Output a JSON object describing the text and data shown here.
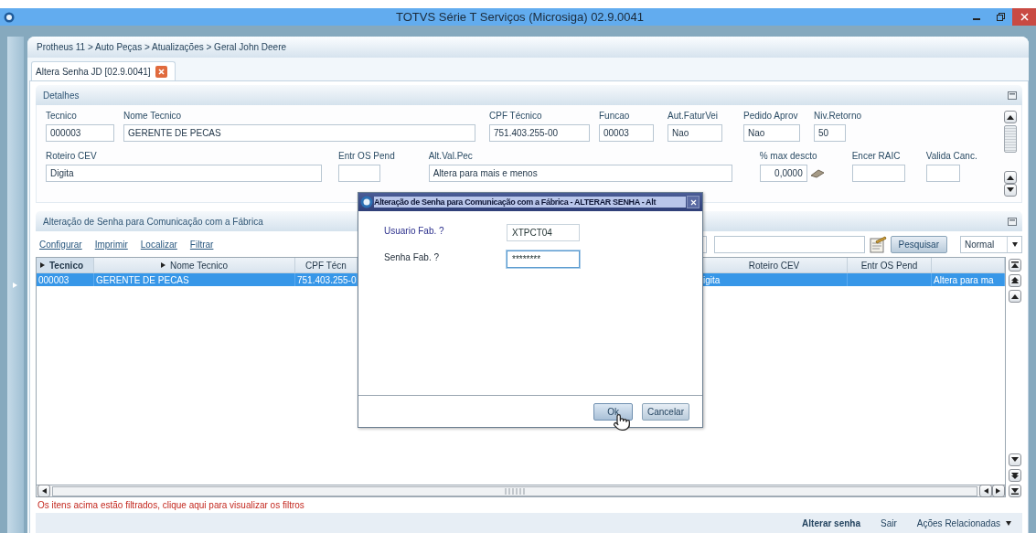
{
  "window": {
    "title": "TOTVS Série T Serviços (Microsiga) 02.9.0041"
  },
  "breadcrumb": "Protheus 11 > Auto Peças > Atualizações > Geral John Deere",
  "tabs": [
    {
      "label": "Altera Senha JD [02.9.0041]",
      "selected": true
    }
  ],
  "details": {
    "title": "Detalhes",
    "fields": [
      {
        "label": "Tecnico",
        "value": "000003"
      },
      {
        "label": "Nome Tecnico",
        "value": "GERENTE DE PECAS"
      },
      {
        "label": "CPF Técnico",
        "value": "751.403.255-00"
      },
      {
        "label": "Funcao",
        "value": "00003"
      },
      {
        "label": "Aut.FaturVei",
        "value": "Nao"
      },
      {
        "label": "Pedido Aprov",
        "value": "Nao"
      },
      {
        "label": "Niv.Retorno",
        "value": "50"
      },
      {
        "label": "Roteiro CEV",
        "value": "Digita"
      },
      {
        "label": "Entr OS Pend"
      },
      {
        "label": "Alt.Val.Pec",
        "value": "Altera para mais e menos"
      },
      {
        "label": "% max descto",
        "value": "0,0000",
        "lookup": true
      },
      {
        "label": "Encer RAIC"
      },
      {
        "label": "Valida Canc."
      }
    ]
  },
  "browse": {
    "title": "Alteração de Senha para Comunicação com a Fábrica",
    "actions": [
      "Configurar",
      "Imprimir",
      "Localizar",
      "Filtrar"
    ],
    "search_button": "Pesquisar",
    "view_select": "Normal",
    "columns": [
      {
        "label": "Tecnico",
        "kind": "expandable",
        "sorted": true
      },
      {
        "label": "Nome Tecnico",
        "kind": "expandable",
        "sorted": false
      },
      {
        "label": "CPF Técn",
        "kind": "plain",
        "sorted": false
      },
      {
        "label": "Roteiro CEV",
        "kind": "plain",
        "sorted": false
      },
      {
        "label": "Entr OS Pend",
        "kind": "plain",
        "sorted": false
      },
      {
        "kind": "plain",
        "sorted": false
      }
    ],
    "rows": [
      {
        "selected": true,
        "cells": [
          "000003",
          "GERENTE DE PECAS",
          "751.403.255-0",
          "igita",
          null,
          "Altera para ma"
        ]
      }
    ],
    "filter_notice": "Os itens acima estão filtrados, clique aqui para visualizar os filtros",
    "footer_actions": [
      {
        "label": "Alterar senha",
        "kind": "primary"
      },
      {
        "label": "Sair",
        "kind": "link"
      },
      {
        "label": "Ações Relacionadas",
        "kind": "menu"
      }
    ]
  },
  "dialog": {
    "title": "Alteração de Senha para Comunicação com a Fábrica - ALTERAR SENHA - Alt",
    "fields": [
      {
        "label": "Usuario Fab. ?",
        "value": "XTPCT04",
        "focused": false
      },
      {
        "label": "Senha Fab.  ?",
        "value": "********",
        "focused": true
      }
    ],
    "buttons": [
      {
        "label": "Ok",
        "hovered": true
      },
      {
        "label": "Cancelar",
        "hovered": false
      }
    ]
  }
}
